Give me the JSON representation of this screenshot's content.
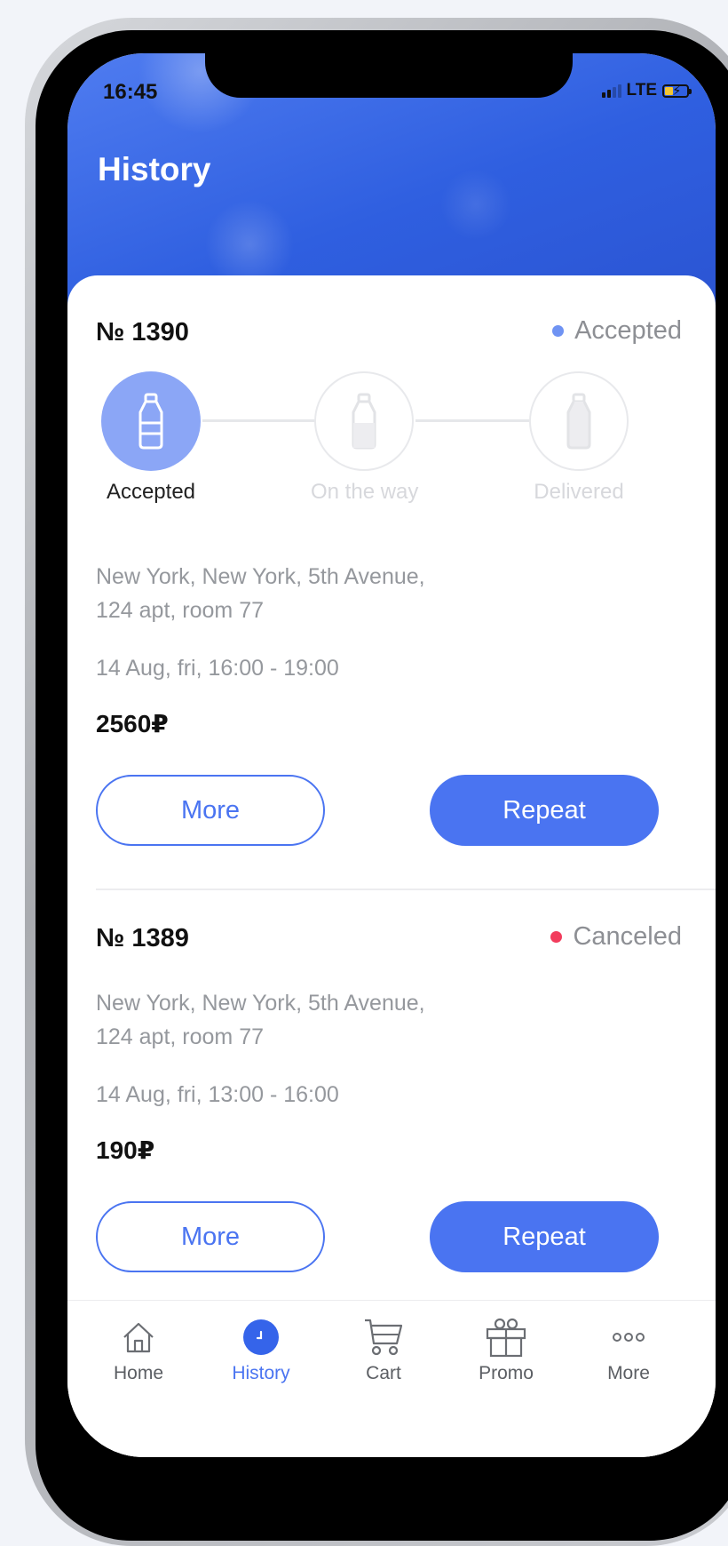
{
  "status_bar": {
    "time": "16:45",
    "network": "LTE"
  },
  "header": {
    "title": "History"
  },
  "orders": [
    {
      "number": "№ 1390",
      "status": "Accepted",
      "status_color": "#6f93f3",
      "steps": [
        {
          "label": "Accepted",
          "active": true
        },
        {
          "label": "On the way",
          "active": false
        },
        {
          "label": "Delivered",
          "active": false
        }
      ],
      "address_line1": "New York, New York, 5th Avenue,",
      "address_line2": "124 apt, room 77",
      "time": "14 Aug, fri, 16:00 - 19:00",
      "price": "2560₽",
      "more_label": "More",
      "repeat_label": "Repeat"
    },
    {
      "number": "№ 1389",
      "status": "Canceled",
      "status_color": "#f23c5c",
      "address_line1": "New York, New York, 5th Avenue,",
      "address_line2": "124 apt, room 77",
      "time": "14 Aug, fri, 13:00 - 16:00",
      "price": "190₽",
      "more_label": "More",
      "repeat_label": "Repeat"
    }
  ],
  "tabbar": {
    "items": [
      {
        "label": "Home",
        "icon": "home-icon",
        "active": false
      },
      {
        "label": "History",
        "icon": "clock-icon",
        "active": true
      },
      {
        "label": "Cart",
        "icon": "cart-icon",
        "active": false
      },
      {
        "label": "Promo",
        "icon": "gift-icon",
        "active": false
      },
      {
        "label": "More",
        "icon": "more-dots-icon",
        "active": false
      }
    ]
  },
  "colors": {
    "accent": "#4a74f1",
    "header": "#2f5fe0"
  }
}
